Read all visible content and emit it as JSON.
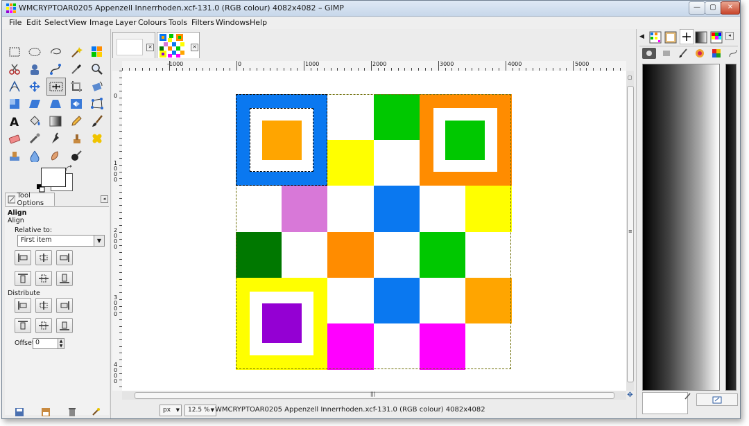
{
  "window": {
    "title": "WMCRYPTOAR0205 Appenzell Innerrhoden.xcf-131.0 (RGB colour) 4082x4082 – GIMP",
    "minimize": "—",
    "maximize": "▢",
    "close": "✕"
  },
  "menu": [
    "File",
    "Edit",
    "Select",
    "View",
    "Image",
    "Layer",
    "Colours",
    "Tools",
    "Filters",
    "Windows",
    "Help"
  ],
  "tool_options": {
    "tab_label": "Tool Options",
    "heading": "Align",
    "subheading": "Align",
    "relative_label": "Relative to:",
    "relative_value": "First item",
    "distribute_label": "Distribute",
    "offset_label": "Offset:",
    "offset_value": "0"
  },
  "ruler": {
    "h_labels": [
      "-1000",
      "0",
      "1000",
      "2000",
      "3000",
      "4000",
      "5000"
    ],
    "v_labels": [
      "0",
      "1000",
      "2000",
      "3000",
      "4000"
    ]
  },
  "status": {
    "unit": "px",
    "zoom": "12.5 %",
    "message": "WMCRYPTOAR0205 Appenzell Innerrhoden.xcf-131.0 (RGB colour) 4082x4082"
  },
  "colors": {
    "blue": "#0a78f0",
    "orange": "#ff8c00",
    "light_orange": "#ffa500",
    "green": "#00c800",
    "dark_green": "#007800",
    "yellow": "#ffff00",
    "violet": "#d878d8",
    "purple": "#9400d3",
    "magenta": "#ff00ff",
    "white": "#ffffff"
  },
  "grid": [
    [
      "blue",
      "blue",
      "white",
      "green",
      "orange",
      "orange"
    ],
    [
      "blue",
      "blue",
      "yellow",
      "white",
      "orange",
      "orange"
    ],
    [
      "white",
      "violet",
      "white",
      "blue",
      "white",
      "yellow"
    ],
    [
      "dark_green",
      "white",
      "orange",
      "white",
      "green",
      "white"
    ],
    [
      "yellow",
      "yellow",
      "white",
      "blue",
      "white",
      "light_orange"
    ],
    [
      "yellow",
      "yellow",
      "magenta",
      "white",
      "magenta",
      "white"
    ]
  ],
  "squares": [
    {
      "row": 0,
      "col": 0,
      "outer": "blue",
      "inner": "light_orange"
    },
    {
      "row": 0,
      "col": 4,
      "outer": "orange",
      "inner": "green"
    },
    {
      "row": 4,
      "col": 0,
      "outer": "yellow",
      "inner": "purple"
    }
  ]
}
